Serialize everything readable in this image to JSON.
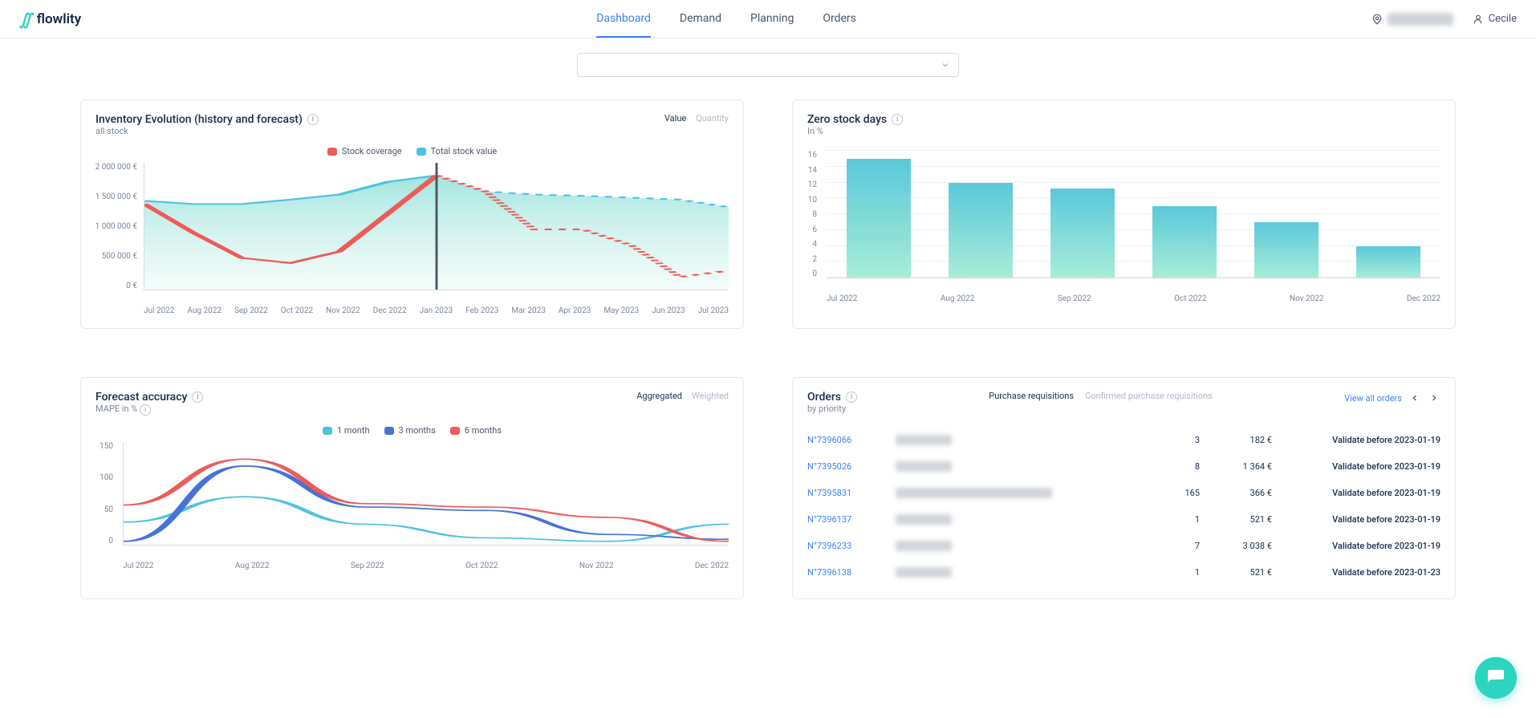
{
  "header": {
    "brand": "flowlity",
    "nav": [
      "Dashboard",
      "Demand",
      "Planning",
      "Orders"
    ],
    "active_nav": 0,
    "location": "████████",
    "user": "Cecile"
  },
  "inventory": {
    "title": "Inventory Evolution (history and forecast)",
    "subtitle": "all stock",
    "toggles": [
      "Value",
      "Quantity"
    ],
    "active_toggle": 0,
    "legend": [
      {
        "label": "Stock coverage",
        "color": "#ef5b5b"
      },
      {
        "label": "Total stock value",
        "color": "#4ec3e0"
      }
    ]
  },
  "zero_stock": {
    "title": "Zero stock days",
    "subtitle": "In %"
  },
  "forecast": {
    "title": "Forecast accuracy",
    "subtitle": "MAPE in %",
    "toggles": [
      "Aggregated",
      "Weighted"
    ],
    "active_toggle": 0,
    "legend": [
      {
        "label": "1 month",
        "color": "#4ec3e0"
      },
      {
        "label": "3 months",
        "color": "#4772d6"
      },
      {
        "label": "6 months",
        "color": "#ef5b5b"
      }
    ]
  },
  "orders": {
    "title": "Orders",
    "subtitle": "by priority",
    "tabs": [
      "Purchase requisitions",
      "Confirmed purchase requisitions"
    ],
    "active_tab": 0,
    "view_all": "View all orders",
    "rows": [
      {
        "id": "N°7396066",
        "desc": "████████",
        "qty": "3",
        "amount": "182 €",
        "deadline": "Validate before 2023-01-19"
      },
      {
        "id": "N°7395026",
        "desc": "████████",
        "qty": "8",
        "amount": "1 364 €",
        "deadline": "Validate before 2023-01-19"
      },
      {
        "id": "N°7395831",
        "desc": "████████████████████████",
        "qty": "165",
        "amount": "366 €",
        "deadline": "Validate before 2023-01-19"
      },
      {
        "id": "N°7396137",
        "desc": "████████",
        "qty": "1",
        "amount": "521 €",
        "deadline": "Validate before 2023-01-19"
      },
      {
        "id": "N°7396233",
        "desc": "████████",
        "qty": "7",
        "amount": "3 038 €",
        "deadline": "Validate before 2023-01-19"
      },
      {
        "id": "N°7396138",
        "desc": "████████",
        "qty": "1",
        "amount": "521 €",
        "deadline": "Validate before 2023-01-23"
      }
    ]
  },
  "chart_data": [
    {
      "id": "inventory",
      "type": "line+area",
      "xlabel": "",
      "ylabel": "€",
      "ylim": [
        0,
        2000000
      ],
      "y_ticks": [
        "2 000 000 €",
        "1 500 000 €",
        "1 000 000 €",
        "500 000 €",
        "0 €"
      ],
      "categories": [
        "Jul 2022",
        "Aug 2022",
        "Sep 2022",
        "Oct 2022",
        "Nov 2022",
        "Dec 2022",
        "Jan 2023",
        "Feb 2023",
        "Mar 2023",
        "Apr 2023",
        "May 2023",
        "Jun 2023",
        "Jul 2023"
      ],
      "series": [
        {
          "name": "Total stock value",
          "values": [
            1400000,
            1350000,
            1350000,
            1420000,
            1500000,
            1700000,
            1800000,
            1550000,
            1500000,
            1480000,
            1450000,
            1420000,
            1300000
          ]
        },
        {
          "name": "Stock coverage",
          "values": [
            1350000,
            900000,
            500000,
            420000,
            600000,
            1200000,
            1800000,
            1550000,
            950000,
            950000,
            700000,
            200000,
            300000
          ]
        }
      ],
      "forecast_start_index": 6
    },
    {
      "id": "zero_stock",
      "type": "bar",
      "xlabel": "",
      "ylabel": "%",
      "ylim": [
        0,
        16
      ],
      "y_ticks": [
        "16",
        "14",
        "12",
        "10",
        "8",
        "6",
        "4",
        "2",
        "0"
      ],
      "categories": [
        "Jul 2022",
        "Aug 2022",
        "Sep 2022",
        "Oct 2022",
        "Nov 2022",
        "Dec 2022"
      ],
      "values": [
        15,
        12,
        11.2,
        9,
        7,
        4
      ]
    },
    {
      "id": "forecast",
      "type": "line",
      "xlabel": "",
      "ylabel": "%",
      "ylim": [
        0,
        150
      ],
      "y_ticks": [
        "150",
        "100",
        "50",
        "0"
      ],
      "categories": [
        "Jul 2022",
        "Aug 2022",
        "Sep 2022",
        "Oct 2022",
        "Nov 2022",
        "Dec 2022"
      ],
      "series": [
        {
          "name": "1 month",
          "values": [
            33,
            70,
            30,
            10,
            5,
            30
          ]
        },
        {
          "name": "3 months",
          "values": [
            5,
            115,
            55,
            50,
            15,
            8
          ]
        },
        {
          "name": "6 months",
          "values": [
            58,
            125,
            60,
            55,
            40,
            5
          ]
        }
      ]
    }
  ]
}
